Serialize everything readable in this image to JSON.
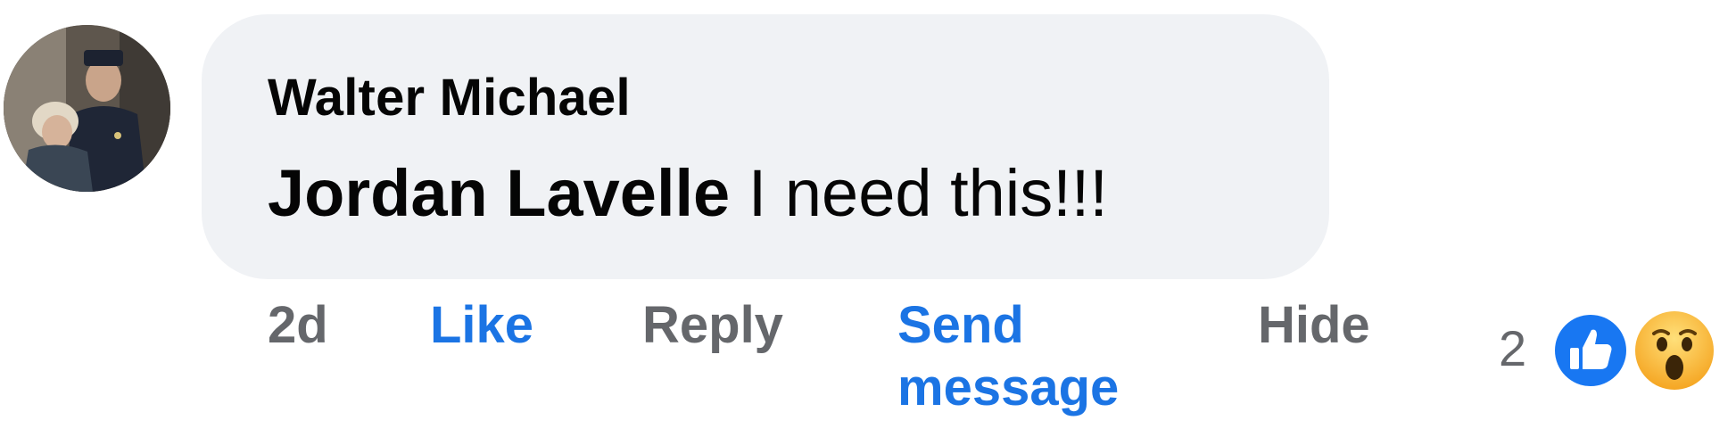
{
  "comment": {
    "author": "Walter Michael",
    "mention": "Jordan Lavelle",
    "text": " I need this!!!"
  },
  "actions": {
    "timestamp": "2d",
    "like_label": "Like",
    "reply_label": "Reply",
    "send_message_label": "Send message",
    "hide_label": "Hide"
  },
  "reactions": {
    "count": "2",
    "icons": [
      "like-reaction-icon",
      "wow-reaction-icon"
    ]
  },
  "colors": {
    "bubble_bg": "#f0f2f5",
    "link_blue": "#1b74e4",
    "muted_gray": "#65676b",
    "text": "#050505"
  }
}
